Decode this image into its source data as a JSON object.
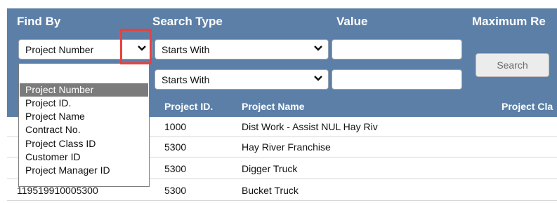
{
  "headers": {
    "find_by": "Find By",
    "search_type": "Search Type",
    "value": "Value",
    "maximum": "Maximum Re"
  },
  "find_by_select": {
    "value": "Project Number",
    "icon": "chevron-down-icon"
  },
  "search_type_selects": [
    "Starts With",
    "Starts With"
  ],
  "search_button": "Search",
  "find_by_options": [
    {
      "label": "Project Number",
      "selected": true
    },
    {
      "label": "Project ID.",
      "selected": false
    },
    {
      "label": "Project Name",
      "selected": false
    },
    {
      "label": "Contract No.",
      "selected": false
    },
    {
      "label": "Project Class ID",
      "selected": false
    },
    {
      "label": "Customer ID",
      "selected": false
    },
    {
      "label": "Project Manager ID",
      "selected": false
    }
  ],
  "table": {
    "columns": [
      "Project ID.",
      "Project Name",
      "Project Cla"
    ],
    "rows": [
      {
        "project_number": "",
        "project_id": "1000",
        "project_name": "Dist Work - Assist NUL Hay Riv"
      },
      {
        "project_number": "",
        "project_id": "5300",
        "project_name": "Hay River Franchise"
      },
      {
        "project_number": "",
        "project_id": "5300",
        "project_name": "Digger Truck"
      },
      {
        "project_number": "119519910005300",
        "project_id": "5300",
        "project_name": "Bucket Truck"
      }
    ]
  },
  "colors": {
    "panel": "#5c7fa7",
    "highlight": "#e8413f",
    "selected_option": "#7b7b7b"
  }
}
